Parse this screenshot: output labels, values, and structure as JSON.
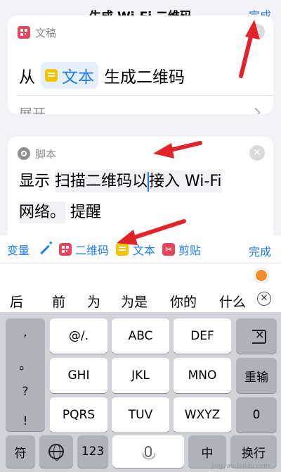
{
  "navbar": {
    "title": "生成 Wi-Fi 二维码",
    "done": "完成"
  },
  "card1": {
    "app_label": "文稿",
    "action_prefix": "从",
    "token_label": "文本",
    "action_suffix": "生成二维码",
    "expand_label": "展开"
  },
  "card2": {
    "app_label": "脚本",
    "text_prefix": "显示 ",
    "text_part1": "扫描二维码以",
    "text_part2": "接入 Wi-Fi",
    "text_line2": "网络。",
    "text_suffix": "提醒"
  },
  "variable_bar": {
    "variable_label": "变量",
    "qr_label": "二维码",
    "text_label": "文本",
    "clipboard_label": "剪贴",
    "done_label": "完成"
  },
  "candidates": [
    "后",
    "前",
    "为",
    "为是",
    "你的",
    "什么"
  ],
  "keyboard": {
    "side": [
      ",",
      "。",
      "?",
      "!"
    ],
    "row1": [
      "@/.",
      "ABC",
      "DEF"
    ],
    "row2": [
      "GHI",
      "JKL",
      "MNO"
    ],
    "row3": [
      "PQRS",
      "TUV",
      "WXYZ"
    ],
    "enter": "重输",
    "zero": "0",
    "symbols": "符",
    "numbers": "123",
    "lang": "中",
    "next": "换行"
  },
  "watermark": "jingyan.baidu.com",
  "colors": {
    "accent": "#1e7cf5",
    "arrow": "#e3232a",
    "token_bg": "#e6f0fd"
  }
}
